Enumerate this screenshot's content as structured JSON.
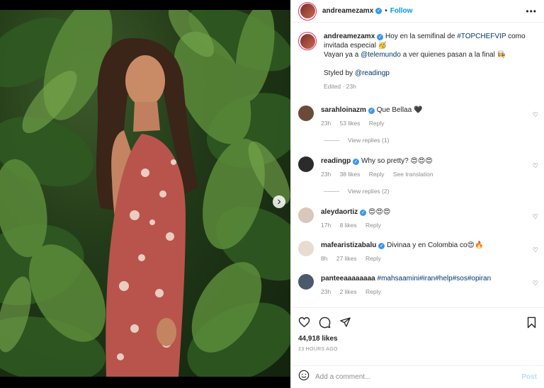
{
  "post": {
    "username": "andreamezamx",
    "follow_label": "Follow",
    "caption_line1": "Hoy en la semifinal de",
    "caption_hashtag": "#TOPCHEFVIP",
    "caption_line1b": "como invitada especial 🥳",
    "caption_line2a": "Vayan ya a",
    "caption_mention1": "@telemundo",
    "caption_line2b": "a ver quienes pasan a la final 👩‍🍳",
    "caption_line3a": "Styled by",
    "caption_mention2": "@readingp",
    "caption_meta": "Edited · 23h",
    "likes": "44,918 likes",
    "posted_ago": "23 HOURS AGO"
  },
  "comments": [
    {
      "user": "sarahloinazm",
      "verified": true,
      "text": "Que Bellaa 🖤",
      "time": "23h",
      "likes": "53 likes",
      "reply": "Reply",
      "avatar_color": "#6b4a3a",
      "replies": "View replies (1)"
    },
    {
      "user": "readingp",
      "verified": true,
      "text": "Why so pretty? 😍😍😍",
      "time": "23h",
      "likes": "38 likes",
      "reply": "Reply",
      "extra": "See translation",
      "avatar_color": "#2b2b2b",
      "replies": "View replies (2)"
    },
    {
      "user": "aleydaortiz",
      "verified": true,
      "text": "😍😍😍",
      "time": "17h",
      "likes": "8 likes",
      "reply": "Reply",
      "avatar_color": "#d9c7b9"
    },
    {
      "user": "mafearistizabalu",
      "verified": true,
      "text": "Divinaa y en Colombia co😍🔥",
      "time": "8h",
      "likes": "27 likes",
      "reply": "Reply",
      "avatar_color": "#e8dcd0"
    },
    {
      "user": "panteeaaaaaaaa",
      "verified": false,
      "text": "#mahsaamini#iran#help#sos#opiran",
      "time": "23h",
      "likes": "2 likes",
      "reply": "Reply",
      "avatar_color": "#4a5a6a"
    }
  ],
  "add_comment_placeholder": "Add a comment...",
  "post_button": "Post",
  "icons": {
    "like": "heart-icon",
    "comment": "comment-icon",
    "share": "paper-plane-icon",
    "save": "bookmark-icon",
    "emoji": "smiley-icon",
    "more": "more-horizontal-icon",
    "next": "chevron-right-icon"
  },
  "colors": {
    "accent": "#0095f6",
    "verified": "#3897f0",
    "link": "#00376b",
    "muted": "#8e8e8e"
  }
}
